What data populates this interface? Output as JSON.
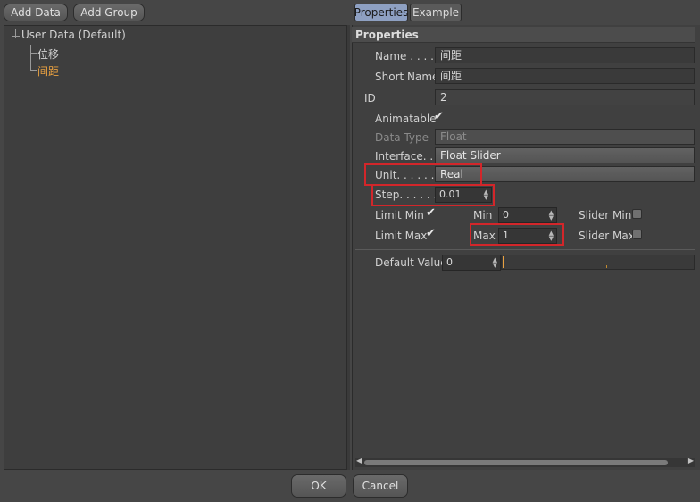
{
  "toolbar": {
    "add_data": "Add Data",
    "add_group": "Add Group"
  },
  "tree": {
    "root": "User Data (Default)",
    "items": [
      {
        "label": "位移",
        "selected": false
      },
      {
        "label": "间距",
        "selected": true
      }
    ],
    "selected_color": "#e8a040"
  },
  "tabs": [
    {
      "label": "Properties",
      "active": true
    },
    {
      "label": "Example",
      "active": false
    }
  ],
  "properties": {
    "header": "Properties",
    "name_label": "Name . . . . .",
    "name_value": "间距",
    "short_name_label": "Short Name",
    "short_name_value": "间距",
    "id_label": "ID",
    "id_value": "2",
    "animatable_label": "Animatable",
    "data_type_label": "Data Type",
    "data_type_value": "Float",
    "interface_label": "Interface. . .",
    "interface_value": "Float Slider",
    "unit_label": "Unit. . . . . . .",
    "unit_value": "Real",
    "step_label": "Step. . . . . . .",
    "step_value": "0.01",
    "limit_min_label": "Limit Min",
    "min_label": "Min",
    "min_value": "0",
    "slider_min_label": "Slider Min",
    "limit_max_label": "Limit Max",
    "max_label": "Max",
    "max_value": "1",
    "slider_max_label": "Slider Max",
    "default_value_label": "Default Value",
    "default_value": "0",
    "check_glyph": "✔"
  },
  "footer": {
    "ok": "OK",
    "cancel": "Cancel"
  },
  "colors": {
    "highlight": "#d3262a",
    "tab_active": "#8ea0c2"
  }
}
